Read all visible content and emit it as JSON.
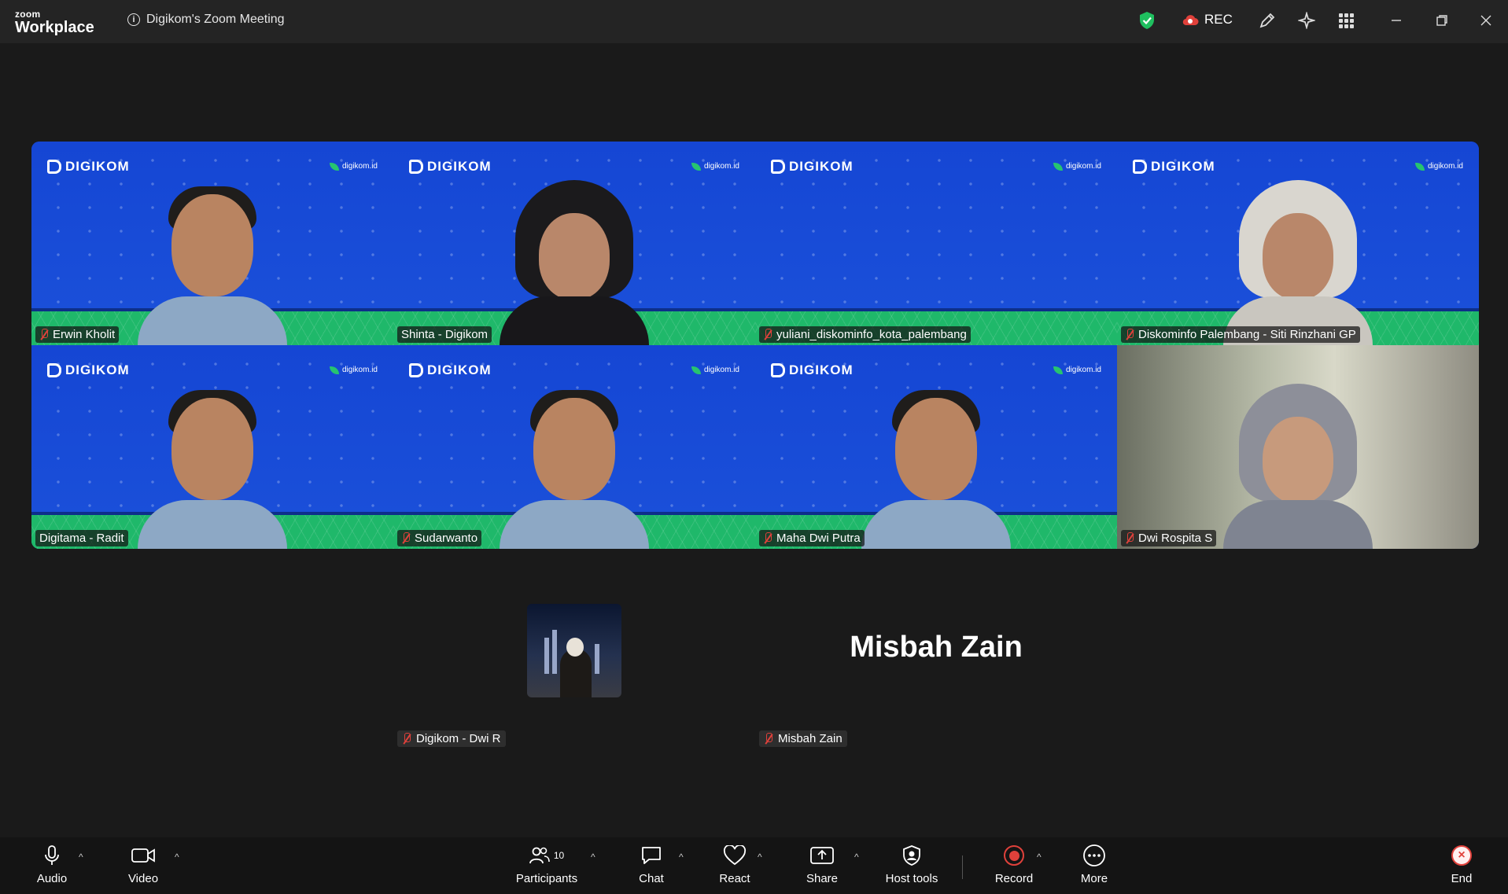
{
  "app": {
    "brand_small": "zoom",
    "brand_large": "Workplace",
    "meeting_title": "Digikom's Zoom Meeting",
    "rec_label": "REC"
  },
  "tile_branding": {
    "logo_text": "DIGIKOM",
    "site_text": "digikom.id"
  },
  "participants": [
    {
      "name": "Erwin Kholit",
      "muted": true,
      "active": false,
      "style": "male"
    },
    {
      "name": "Shinta - Digikom",
      "muted": false,
      "active": false,
      "style": "hijab"
    },
    {
      "name": "yuliani_diskominfo_kota_palembang",
      "muted": true,
      "active": false,
      "style": "none"
    },
    {
      "name": "Diskominfo Palembang  - Siti Rinzhani GP",
      "muted": true,
      "active": false,
      "style": "hijab"
    },
    {
      "name": "Digitama - Radit",
      "muted": false,
      "active": true,
      "style": "male"
    },
    {
      "name": "Sudarwanto",
      "muted": true,
      "active": false,
      "style": "male"
    },
    {
      "name": "Maha Dwi Putra",
      "muted": true,
      "active": false,
      "style": "male"
    },
    {
      "name": "Dwi Rospita S",
      "muted": true,
      "active": false,
      "style": "room"
    }
  ],
  "video_off": [
    {
      "name": "Digikom - Dwi R",
      "muted": true
    },
    {
      "name": "Misbah Zain",
      "muted": true,
      "display_name": "Misbah Zain"
    }
  ],
  "toolbar": {
    "audio": "Audio",
    "video": "Video",
    "participants": "Participants",
    "participants_count": "10",
    "chat": "Chat",
    "react": "React",
    "share": "Share",
    "host_tools": "Host tools",
    "record": "Record",
    "more": "More",
    "end": "End"
  },
  "colors": {
    "accent_green": "#2ddc86",
    "mute_red": "#e0413b",
    "tile_blue": "#1747c8",
    "tile_green": "#1fb86a"
  }
}
